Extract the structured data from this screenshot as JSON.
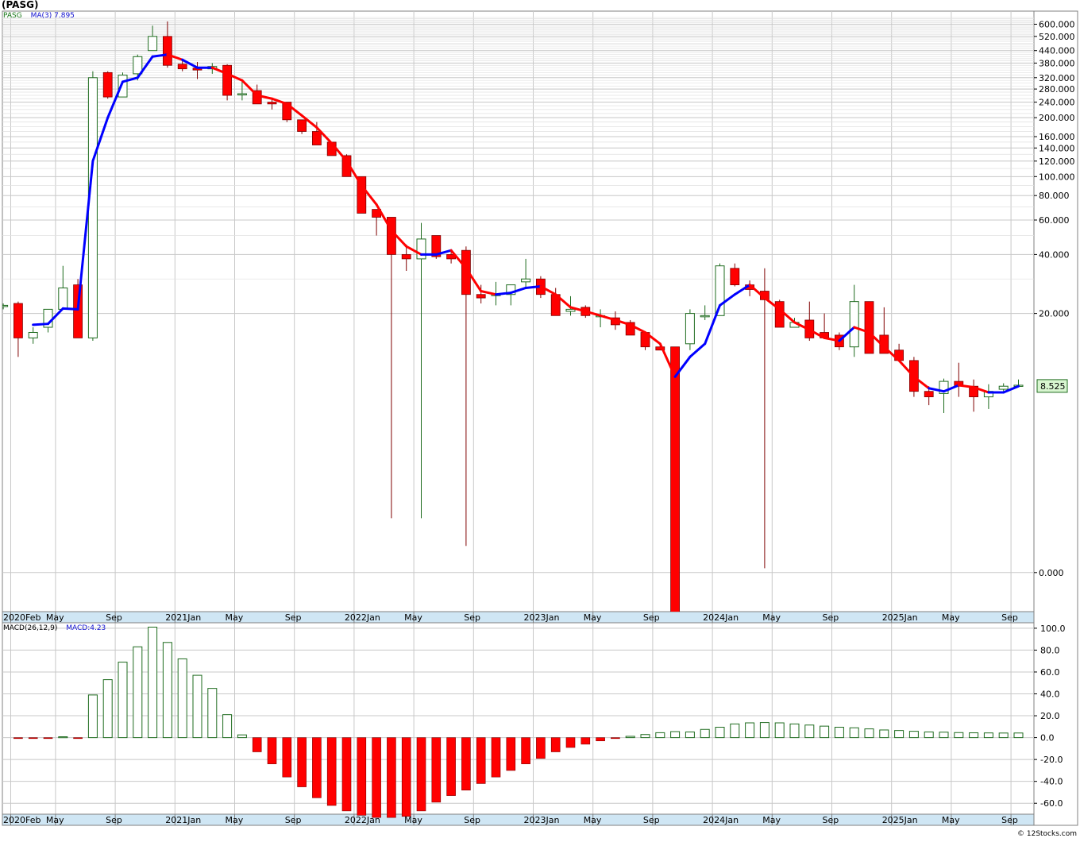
{
  "header": {
    "title": "(PASG)",
    "price_legend": {
      "ticker": "PASG",
      "ma_label": "MA(3)",
      "ma_value": "7.895"
    },
    "macd_legend": {
      "label": "MACD(26,12,9)",
      "value_label": "MACD:4.23"
    },
    "last_price_badge": "8.525",
    "footer": "© 12Stocks.com"
  },
  "colors": {
    "up_candle": "#1e6b1e",
    "down_candle": "#ff0000",
    "ma_down": "#ff0000",
    "ma_up": "#0000ff",
    "grid": "#c8c8c8",
    "axis_strip": "#cfe6f4",
    "badge_bg": "#d8f5d0",
    "badge_border": "#1e6b1e"
  },
  "chart_data": [
    {
      "type": "candlestick",
      "title": "(PASG)",
      "y_scale": "log",
      "ylim": [
        0.6,
        700
      ],
      "y_ticks": [
        "0.000",
        "20.000",
        "40.000",
        "60.000",
        "80.000",
        "100.000",
        "120.000",
        "140.000",
        "160.000",
        "200.000",
        "240.000",
        "280.000",
        "320.000",
        "380.000",
        "440.000",
        "520.000",
        "600.000"
      ],
      "y_tick_values": [
        0.95,
        20,
        40,
        60,
        80,
        100,
        120,
        140,
        160,
        200,
        240,
        280,
        320,
        380,
        440,
        520,
        600
      ],
      "x_ticks": [
        "2020Feb",
        "May",
        "Sep",
        "2021Jan",
        "May",
        "Sep",
        "2022Jan",
        "May",
        "Sep",
        "2023Jan",
        "May",
        "Sep",
        "2024Jan",
        "May",
        "Sep",
        "2025Jan",
        "May",
        "Sep"
      ],
      "x_tick_months": [
        0,
        3,
        7,
        11,
        15,
        19,
        23,
        27,
        31,
        35,
        39,
        43,
        47,
        51,
        55,
        59,
        63,
        67
      ],
      "candles_fields": [
        "month",
        "open",
        "high",
        "low",
        "close"
      ],
      "candles": [
        [
          -0.5,
          22,
          22.5,
          21,
          22
        ],
        [
          0.5,
          22.5,
          23,
          12,
          15
        ],
        [
          1.5,
          15,
          17,
          14,
          16
        ],
        [
          2.5,
          17,
          21,
          16,
          21
        ],
        [
          3.5,
          21,
          35,
          21,
          27
        ],
        [
          4.5,
          28,
          30,
          15,
          15
        ],
        [
          5.5,
          15,
          345,
          14.5,
          320
        ],
        [
          6.5,
          340,
          345,
          250,
          255
        ],
        [
          7.5,
          255,
          340,
          255,
          330
        ],
        [
          8.5,
          335,
          420,
          310,
          410
        ],
        [
          9.5,
          440,
          590,
          440,
          520
        ],
        [
          10.5,
          520,
          620,
          360,
          370
        ],
        [
          11.5,
          375,
          400,
          345,
          355
        ],
        [
          12.5,
          358,
          385,
          315,
          350
        ],
        [
          13.5,
          355,
          380,
          335,
          365
        ],
        [
          14.5,
          370,
          375,
          245,
          260
        ],
        [
          15.5,
          265,
          305,
          245,
          265
        ],
        [
          16.5,
          275,
          295,
          235,
          235
        ],
        [
          17.5,
          240,
          250,
          220,
          235
        ],
        [
          18.5,
          240,
          240,
          190,
          195
        ],
        [
          19.5,
          195,
          195,
          165,
          170
        ],
        [
          20.5,
          170,
          190,
          145,
          145
        ],
        [
          21.5,
          150,
          150,
          130,
          128
        ],
        [
          22.5,
          128,
          130,
          100,
          100
        ],
        [
          23.5,
          100,
          100,
          65,
          65
        ],
        [
          24.5,
          68,
          68,
          50,
          62
        ],
        [
          25.5,
          62,
          62,
          1.8,
          40
        ],
        [
          26.5,
          40,
          45,
          33,
          38
        ],
        [
          27.5,
          38,
          58,
          1.8,
          48
        ],
        [
          28.5,
          50,
          50,
          38,
          39
        ],
        [
          29.5,
          40,
          42,
          36,
          38
        ],
        [
          30.5,
          42,
          44,
          1.3,
          25
        ],
        [
          31.5,
          25,
          28,
          22.5,
          24
        ],
        [
          32.5,
          25,
          29,
          22,
          25
        ],
        [
          33.5,
          25,
          28,
          22,
          28
        ],
        [
          34.5,
          29,
          38,
          27,
          30
        ],
        [
          35.5,
          30,
          31,
          24,
          25
        ],
        [
          36.5,
          25,
          27,
          19.5,
          19.5
        ],
        [
          37.5,
          20.5,
          24.5,
          19.5,
          21
        ],
        [
          38.5,
          21.5,
          22,
          19,
          19.5
        ],
        [
          39.5,
          19.5,
          21,
          17,
          19.5
        ],
        [
          40.5,
          19,
          20.5,
          16.5,
          17.5
        ],
        [
          41.5,
          18,
          18.5,
          16,
          15.5
        ],
        [
          42.5,
          16,
          16,
          13,
          13.5
        ],
        [
          43.5,
          13.5,
          14,
          13,
          13
        ],
        [
          44.5,
          13.5,
          13.5,
          0.3,
          0.5
        ],
        [
          45.5,
          14,
          21,
          13,
          20
        ],
        [
          46.5,
          19.5,
          22,
          18.5,
          19.5
        ],
        [
          47.5,
          19.5,
          36,
          19.5,
          35
        ],
        [
          48.5,
          34,
          36,
          27.5,
          28
        ],
        [
          49.5,
          28,
          29.5,
          24.5,
          26.5
        ],
        [
          50.5,
          26,
          34,
          1.0,
          23.5
        ],
        [
          51.5,
          23,
          23.5,
          17,
          17
        ],
        [
          52.5,
          17,
          19,
          17,
          18
        ],
        [
          53.5,
          18.5,
          23,
          14.5,
          15
        ],
        [
          54.5,
          16,
          20,
          15,
          15
        ],
        [
          55.5,
          15.5,
          16,
          13,
          13.5
        ],
        [
          56.5,
          13.5,
          28,
          12,
          23
        ],
        [
          57.5,
          23,
          23,
          12.5,
          12.5
        ],
        [
          58.5,
          15.5,
          21.5,
          12.5,
          12.5
        ],
        [
          59.5,
          13,
          14,
          11.5,
          11.5
        ],
        [
          60.5,
          11.5,
          12,
          7.5,
          8
        ],
        [
          61.5,
          8,
          8.5,
          6.8,
          7.5
        ],
        [
          62.5,
          7.8,
          9.3,
          6.2,
          9
        ],
        [
          63.5,
          9,
          11.2,
          7.5,
          8.5
        ],
        [
          64.5,
          8.5,
          9.2,
          6.3,
          7.5
        ],
        [
          65.5,
          7.5,
          8.7,
          6.5,
          8
        ],
        [
          66.5,
          8.2,
          8.8,
          8,
          8.5
        ],
        [
          67.5,
          8.5,
          9.2,
          8.4,
          8.6
        ]
      ],
      "ma_series": {
        "name": "MA(3)",
        "months": [
          1.5,
          2.5,
          3.5,
          4.5,
          5.5,
          6.5,
          7.5,
          8.5,
          9.5,
          10.5,
          11.5,
          12.5,
          13.5,
          14.5,
          15.5,
          16.5,
          17.5,
          18.5,
          19.5,
          20.5,
          21.5,
          22.5,
          23.5,
          24.5,
          25.5,
          26.5,
          27.5,
          28.5,
          29.5,
          30.5,
          31.5,
          32.5,
          33.5,
          34.5,
          35.5,
          36.5,
          37.5,
          38.5,
          39.5,
          40.5,
          41.5,
          42.5,
          43.5,
          44.5,
          45.5,
          46.5,
          47.5,
          48.5,
          49.5,
          50.5,
          51.5,
          52.5,
          53.5,
          54.5,
          55.5,
          56.5,
          57.5,
          58.5,
          59.5,
          60.5,
          61.5,
          62.5,
          63.5,
          64.5,
          65.5,
          66.5,
          67.5
        ],
        "values": [
          17.5,
          17.7,
          21.2,
          21,
          120,
          200,
          305,
          320,
          410,
          420,
          395,
          360,
          360,
          335,
          310,
          260,
          250,
          235,
          205,
          178,
          148,
          120,
          90,
          72,
          53,
          44,
          40,
          40,
          42,
          34,
          26,
          25,
          25.5,
          27,
          27.5,
          25,
          21.5,
          20.5,
          19.5,
          18.5,
          17.5,
          16,
          14,
          9.5,
          12,
          14,
          22,
          25,
          28,
          24,
          21,
          18,
          16.5,
          15,
          14.5,
          17,
          16,
          13.5,
          11.5,
          9.5,
          8.3,
          8,
          8.6,
          8.4,
          7.9,
          7.9,
          8.5
        ],
        "up_flags": [
          1,
          1,
          1,
          1,
          1,
          1,
          1,
          1,
          1,
          1,
          0,
          1,
          1,
          0,
          0,
          0,
          0,
          0,
          0,
          0,
          0,
          0,
          0,
          0,
          0,
          0,
          0,
          1,
          1,
          0,
          0,
          0,
          1,
          1,
          1,
          0,
          0,
          0,
          0,
          0,
          0,
          0,
          0,
          0,
          1,
          1,
          1,
          1,
          1,
          0,
          0,
          0,
          0,
          0,
          0,
          1,
          0,
          0,
          0,
          0,
          0,
          1,
          1,
          0,
          0,
          1,
          1
        ]
      },
      "last_value": 8.525
    },
    {
      "type": "bar",
      "title": "MACD(26,12,9)",
      "ylim": [
        -70,
        105
      ],
      "y_ticks": [
        "100.0",
        "80.0",
        "60.0",
        "40.0",
        "20.0",
        "0.0",
        "-20.0",
        "-40.0",
        "-60.0"
      ],
      "y_tick_values": [
        100,
        80,
        60,
        40,
        20,
        0,
        -20,
        -40,
        -60
      ],
      "x_ticks": [
        "2020Feb",
        "May",
        "Sep",
        "2021Jan",
        "May",
        "Sep",
        "2022Jan",
        "May",
        "Sep",
        "2023Jan",
        "May",
        "Sep",
        "2024Jan",
        "May",
        "Sep",
        "2025Jan",
        "May",
        "Sep"
      ],
      "x_tick_months": [
        0,
        3,
        7,
        11,
        15,
        19,
        23,
        27,
        31,
        35,
        39,
        43,
        47,
        51,
        55,
        59,
        63,
        67
      ],
      "months": [
        0.5,
        1.5,
        2.5,
        3.5,
        4.5,
        5.5,
        6.5,
        7.5,
        8.5,
        9.5,
        10.5,
        11.5,
        12.5,
        13.5,
        14.5,
        15.5,
        16.5,
        17.5,
        18.5,
        19.5,
        20.5,
        21.5,
        22.5,
        23.5,
        24.5,
        25.5,
        26.5,
        27.5,
        28.5,
        29.5,
        30.5,
        31.5,
        32.5,
        33.5,
        34.5,
        35.5,
        36.5,
        37.5,
        38.5,
        39.5,
        40.5,
        41.5,
        42.5,
        43.5,
        44.5,
        45.5,
        46.5,
        47.5,
        48.5,
        49.5,
        50.5,
        51.5,
        52.5,
        53.5,
        54.5,
        55.5,
        56.5,
        57.5,
        58.5,
        59.5,
        60.5,
        61.5,
        62.5,
        63.5,
        64.5,
        65.5,
        66.5,
        67.5
      ],
      "values": [
        -0.8,
        -0.8,
        -0.6,
        0.8,
        -0.4,
        39,
        53,
        69,
        83,
        101,
        87,
        72,
        57,
        45,
        21,
        2.5,
        -13,
        -24,
        -36,
        -45,
        -55,
        -62,
        -67,
        -71,
        -73,
        -73,
        -72,
        -67,
        -59,
        -53,
        -48,
        -42,
        -36,
        -30,
        -24,
        -19,
        -13,
        -9,
        -6,
        -3,
        -0.8,
        1.2,
        2.8,
        4.5,
        5.5,
        5.2,
        7.5,
        9.5,
        12.5,
        13.5,
        13.8,
        13.5,
        12.5,
        11.5,
        10.5,
        9.5,
        9,
        8,
        7,
        6.5,
        5.8,
        5.2,
        5,
        4.6,
        4.4,
        4.3,
        4.2,
        4.23
      ]
    }
  ]
}
